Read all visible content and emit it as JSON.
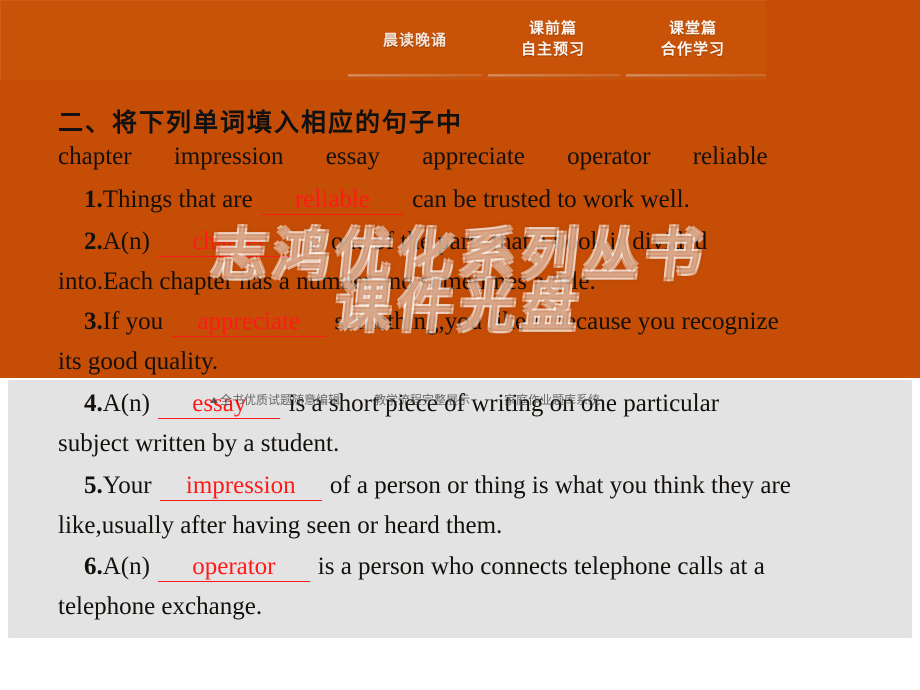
{
  "slide": {
    "background_orange": "#C54D06",
    "background_gray": "#E3E3E3",
    "answer_color": "#FF1A1A"
  },
  "tabs": [
    {
      "line1": "晨读晚诵",
      "line2": ""
    },
    {
      "line1": "课前篇",
      "line2": "自主预习"
    },
    {
      "line1": "课堂篇",
      "line2": "合作学习"
    }
  ],
  "heading": "二、将下列单词填入相应的句子中",
  "word_bank": [
    "chapter",
    "impression",
    "essay",
    "appreciate",
    "operator",
    "reliable"
  ],
  "questions": [
    {
      "num": "1.",
      "before": "Things that are",
      "answer": "reliable",
      "after": "can be trusted to work well.",
      "cont": ""
    },
    {
      "num": "2.",
      "before": "A(n)",
      "answer": "chapter",
      "after": "is one of the parts that a book is divided",
      "cont": "into.Each chapter has a number,and sometimes a title."
    },
    {
      "num": "3.",
      "before": "If you",
      "answer": "appreciate",
      "after": "something,you like it because you recognize",
      "cont": "its good quality."
    },
    {
      "num": "4.",
      "before": "A(n)",
      "answer": "essay",
      "after": "is a short piece of writing on one particular",
      "cont": "subject written by a student."
    },
    {
      "num": "5.",
      "before": "Your",
      "answer": "impression",
      "after": "of a person or thing is what you think they are",
      "cont": "like,usually after having seen or heard them."
    },
    {
      "num": "6.",
      "before": "A(n)",
      "answer": "operator",
      "after": "is a person who connects telephone calls at a",
      "cont": "telephone exchange."
    }
  ],
  "watermarks": {
    "big_line1": "志鸿优化系列丛书",
    "big_line2": "课件光盘",
    "strip_segments": [
      "全书优质试题随意编辑",
      "教学流程完整展示",
      "家庭作业题库系统"
    ]
  }
}
